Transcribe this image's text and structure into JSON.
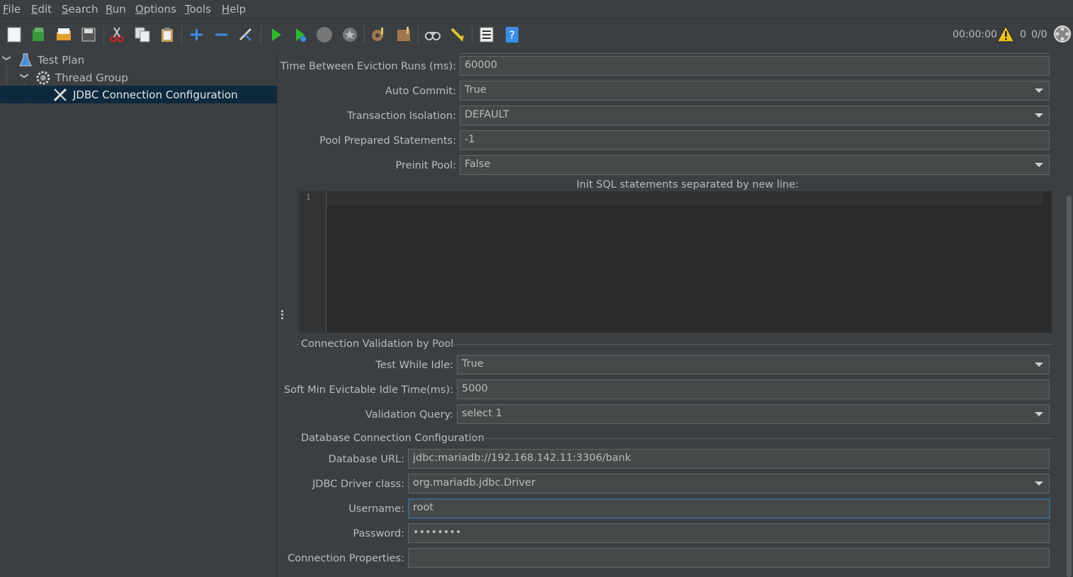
{
  "menu": [
    {
      "first": "F",
      "rest": "ile"
    },
    {
      "first": "E",
      "rest": "dit"
    },
    {
      "first": "S",
      "rest": "earch"
    },
    {
      "first": "R",
      "rest": "un"
    },
    {
      "first": "O",
      "rest": "ptions"
    },
    {
      "first": "T",
      "rest": "ools"
    },
    {
      "first": "H",
      "rest": "elp"
    }
  ],
  "toolbar": {
    "timer": "00:00:00",
    "warning_count": "0",
    "threads": "0/0",
    "icons": [
      "new-icon",
      "templates-icon",
      "open-icon",
      "save-icon",
      "cut-icon",
      "copy-icon",
      "paste-icon",
      "expand-icon",
      "collapse-icon",
      "toggle-icon",
      "start-icon",
      "start-no-pauses-icon",
      "stop-icon",
      "shutdown-icon",
      "clear-icon",
      "clear-all-icon",
      "search-icon",
      "reset-search-icon",
      "function-helper-icon",
      "help-icon"
    ]
  },
  "tree": {
    "items": [
      {
        "label": "Test Plan",
        "icon": "test-plan-icon"
      },
      {
        "label": "Thread Group",
        "icon": "gear-icon"
      },
      {
        "label": "JDBC Connection Configuration",
        "icon": "wrench-screwdriver-icon"
      }
    ]
  },
  "pool": {
    "eviction_label": "Time Between Eviction Runs (ms):",
    "eviction_value": "60000",
    "auto_commit_label": "Auto Commit:",
    "auto_commit_value": "True",
    "isolation_label": "Transaction Isolation:",
    "isolation_value": "DEFAULT",
    "prepared_label": "Pool Prepared Statements:",
    "prepared_value": "-1",
    "preinit_label": "Preinit Pool:",
    "preinit_value": "False",
    "init_sql_label": "Init SQL statements separated by new line:",
    "init_sql_line": "1"
  },
  "validation": {
    "title": "Connection Validation by Pool",
    "test_idle_label": "Test While Idle:",
    "test_idle_value": "True",
    "soft_min_label": "Soft Min Evictable Idle Time(ms):",
    "soft_min_value": "5000",
    "query_label": "Validation Query:",
    "query_value": "select 1"
  },
  "db": {
    "title": "Database Connection Configuration",
    "url_label": "Database URL:",
    "url_value": "jdbc:mariadb://192.168.142.11:3306/bank",
    "driver_label": "JDBC Driver class:",
    "driver_value": "org.mariadb.jdbc.Driver",
    "username_label": "Username:",
    "username_value": "root",
    "password_label": "Password:",
    "password_value": "••••••••",
    "props_label": "Connection Properties:",
    "props_value": ""
  },
  "colors": {
    "background": "#3c3f41",
    "field": "#45494a",
    "selection": "#0d293e",
    "editor": "#2b2b2b",
    "focus": "#3d6185"
  }
}
